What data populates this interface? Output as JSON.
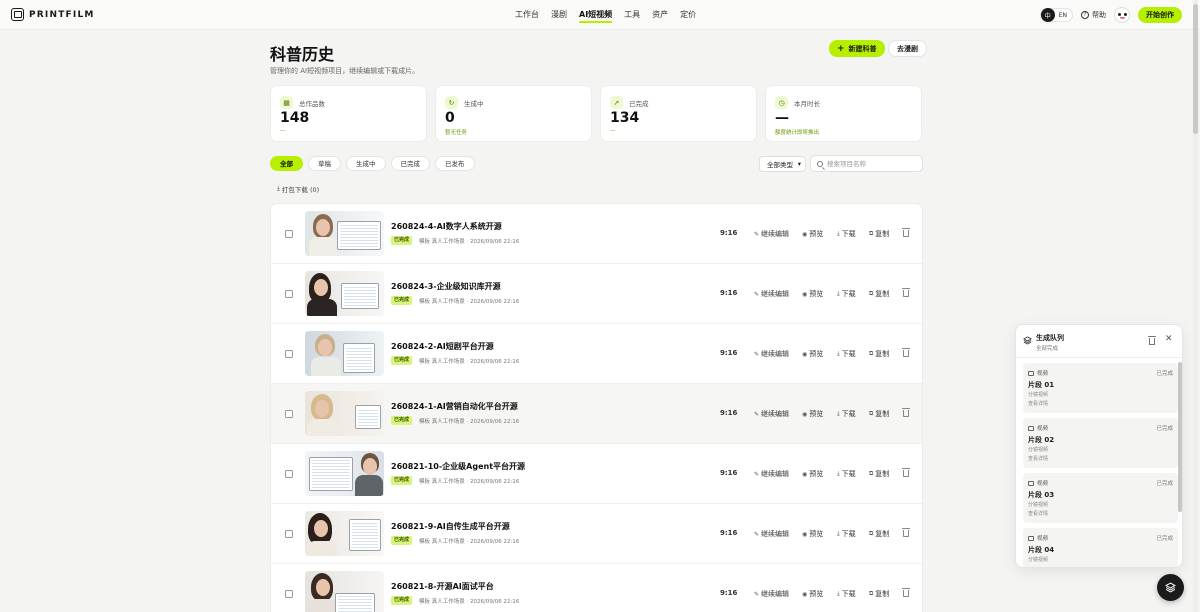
{
  "brand": {
    "name": "PRINTFILM"
  },
  "nav": {
    "items": [
      {
        "label": "工作台",
        "active": false
      },
      {
        "label": "漫剧",
        "active": false
      },
      {
        "label": "AI短视频",
        "active": true
      },
      {
        "label": "工具",
        "active": false
      },
      {
        "label": "资产",
        "active": false
      },
      {
        "label": "定价",
        "active": false
      }
    ]
  },
  "toolbar": {
    "lang": "EN",
    "help": "帮助",
    "start_label": "开始创作"
  },
  "header": {
    "title": "科普历史",
    "subtitle": "管理你的 AI短视频项目，继续编辑或下载成片。",
    "new_label": "新建科普",
    "story_label": "去漫剧"
  },
  "stats": [
    {
      "label": "总作品数",
      "value": "148",
      "note": "—"
    },
    {
      "label": "生成中",
      "value": "0",
      "note": "暂无任务"
    },
    {
      "label": "已完成",
      "value": "134",
      "note": "—"
    },
    {
      "label": "本月时长",
      "value": "—",
      "note": "额度统计即将推出"
    }
  ],
  "filters": [
    "全部",
    "草稿",
    "生成中",
    "已完成",
    "已发布"
  ],
  "type_select": "全部类型",
  "search": {
    "placeholder": "搜索项目名称"
  },
  "pack_download": "打包下载 (0)",
  "row_actions": {
    "edit": "继续编辑",
    "preview": "预览",
    "download": "下载",
    "copy": "复制"
  },
  "projects": [
    {
      "title": "260824-4-AI数字人系统开源",
      "status": "已完成",
      "meta": "模板 真人工作场景 · 2026/09/06 22:16",
      "ratio": "9:16"
    },
    {
      "title": "260824-3-企业级知识库开源",
      "status": "已完成",
      "meta": "模板 真人工作场景 · 2026/09/06 22:16",
      "ratio": "9:16"
    },
    {
      "title": "260824-2-AI短剧平台开源",
      "status": "已完成",
      "meta": "模板 真人工作场景 · 2026/09/06 22:16",
      "ratio": "9:16"
    },
    {
      "title": "260824-1-AI营销自动化平台开源",
      "status": "已完成",
      "meta": "模板 真人工作场景 · 2026/09/06 22:16",
      "ratio": "9:16"
    },
    {
      "title": "260821-10-企业级Agent平台开源",
      "status": "已完成",
      "meta": "模板 真人工作场景 · 2026/09/06 22:16",
      "ratio": "9:16"
    },
    {
      "title": "260821-9-AI自传生成平台开源",
      "status": "已完成",
      "meta": "模板 真人工作场景 · 2026/09/06 22:16",
      "ratio": "9:16"
    },
    {
      "title": "260821-8-开源AI面试平台",
      "status": "已完成",
      "meta": "模板 真人工作场景 · 2026/09/06 22:16",
      "ratio": "9:16"
    }
  ],
  "queue": {
    "title": "生成队列",
    "subtitle": "全部完成",
    "items": [
      {
        "category": "视频",
        "status": "已完成",
        "name": "片段 01",
        "desc": "分镜视频",
        "link": "查看详情"
      },
      {
        "category": "视频",
        "status": "已完成",
        "name": "片段 02",
        "desc": "分镜视频",
        "link": "查看详情"
      },
      {
        "category": "视频",
        "status": "已完成",
        "name": "片段 03",
        "desc": "分镜视频",
        "link": "查看详情"
      },
      {
        "category": "视频",
        "status": "已完成",
        "name": "片段 04",
        "desc": "分镜视频",
        "link": ""
      }
    ]
  },
  "colors": {
    "accent": "#b6f000",
    "badge": "#d8f47a"
  }
}
